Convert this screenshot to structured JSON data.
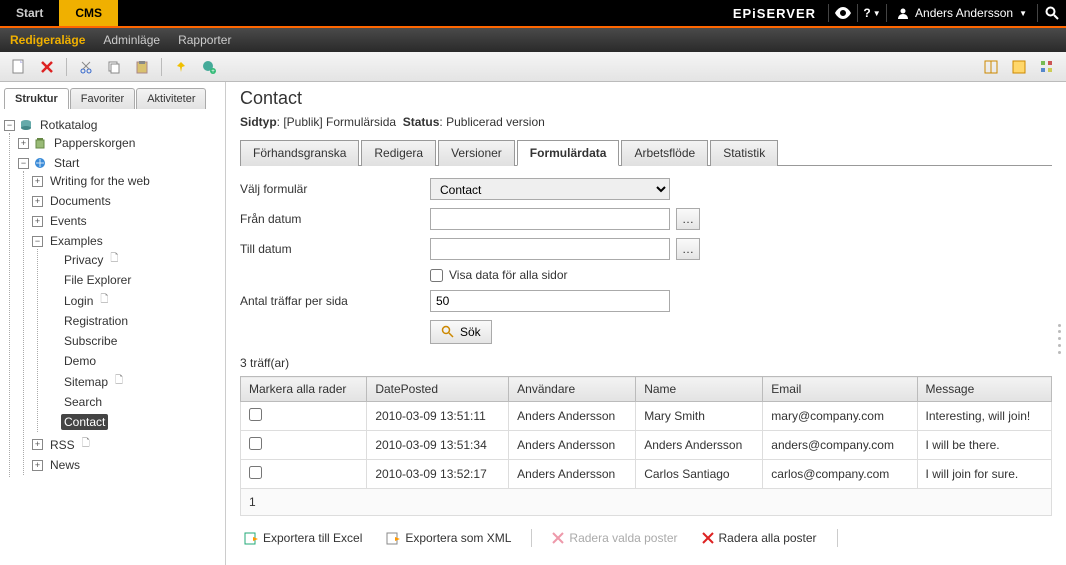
{
  "topbar": {
    "start": "Start",
    "cms": "CMS",
    "brand": "EPiSERVER",
    "help": "?",
    "user": "Anders Andersson"
  },
  "ribbon": {
    "edit": "Redigeraläge",
    "admin": "Adminläge",
    "reports": "Rapporter"
  },
  "sidetabs": {
    "struktur": "Struktur",
    "favoriter": "Favoriter",
    "aktiviteter": "Aktiviteter"
  },
  "tree": {
    "root": "Rotkatalog",
    "trash": "Papperskorgen",
    "start": "Start",
    "writing": "Writing for the web",
    "documents": "Documents",
    "events": "Events",
    "examples": "Examples",
    "privacy": "Privacy",
    "fileexplorer": "File Explorer",
    "login": "Login",
    "registration": "Registration",
    "subscribe": "Subscribe",
    "demo": "Demo",
    "sitemap": "Sitemap",
    "search": "Search",
    "contact": "Contact",
    "rss": "RSS",
    "news": "News"
  },
  "content": {
    "title": "Contact",
    "sidtyp_label": "Sidtyp",
    "sidtyp_value": "[Publik] Formulärsida",
    "status_label": "Status",
    "status_value": "Publicerad version",
    "tabs": {
      "preview": "Förhandsgranska",
      "edit": "Redigera",
      "versions": "Versioner",
      "formdata": "Formulärdata",
      "workflow": "Arbetsflöde",
      "stats": "Statistik"
    },
    "form": {
      "select_label": "Välj formulär",
      "select_value": "Contact",
      "from_label": "Från datum",
      "from_value": "",
      "to_label": "Till datum",
      "to_value": "",
      "allpages_label": "Visa data för alla sidor",
      "perpage_label": "Antal träffar per sida",
      "perpage_value": "50",
      "search_label": "Sök"
    },
    "hits": "3 träff(ar)",
    "table": {
      "headers": {
        "mark": "Markera alla rader",
        "date": "DatePosted",
        "user": "Användare",
        "name": "Name",
        "email": "Email",
        "message": "Message"
      },
      "rows": [
        {
          "date": "2010-03-09 13:51:11",
          "user": "Anders Andersson",
          "name": "Mary Smith",
          "email": "mary@company.com",
          "message": "Interesting, will join!"
        },
        {
          "date": "2010-03-09 13:51:34",
          "user": "Anders Andersson",
          "name": "Anders Andersson",
          "email": "anders@company.com",
          "message": "I will be there."
        },
        {
          "date": "2010-03-09 13:52:17",
          "user": "Anders Andersson",
          "name": "Carlos Santiago",
          "email": "carlos@company.com",
          "message": "I will join for sure."
        }
      ],
      "page": "1"
    },
    "actions": {
      "excel": "Exportera till Excel",
      "xml": "Exportera som XML",
      "delete_sel": "Radera valda poster",
      "delete_all": "Radera alla poster"
    }
  }
}
